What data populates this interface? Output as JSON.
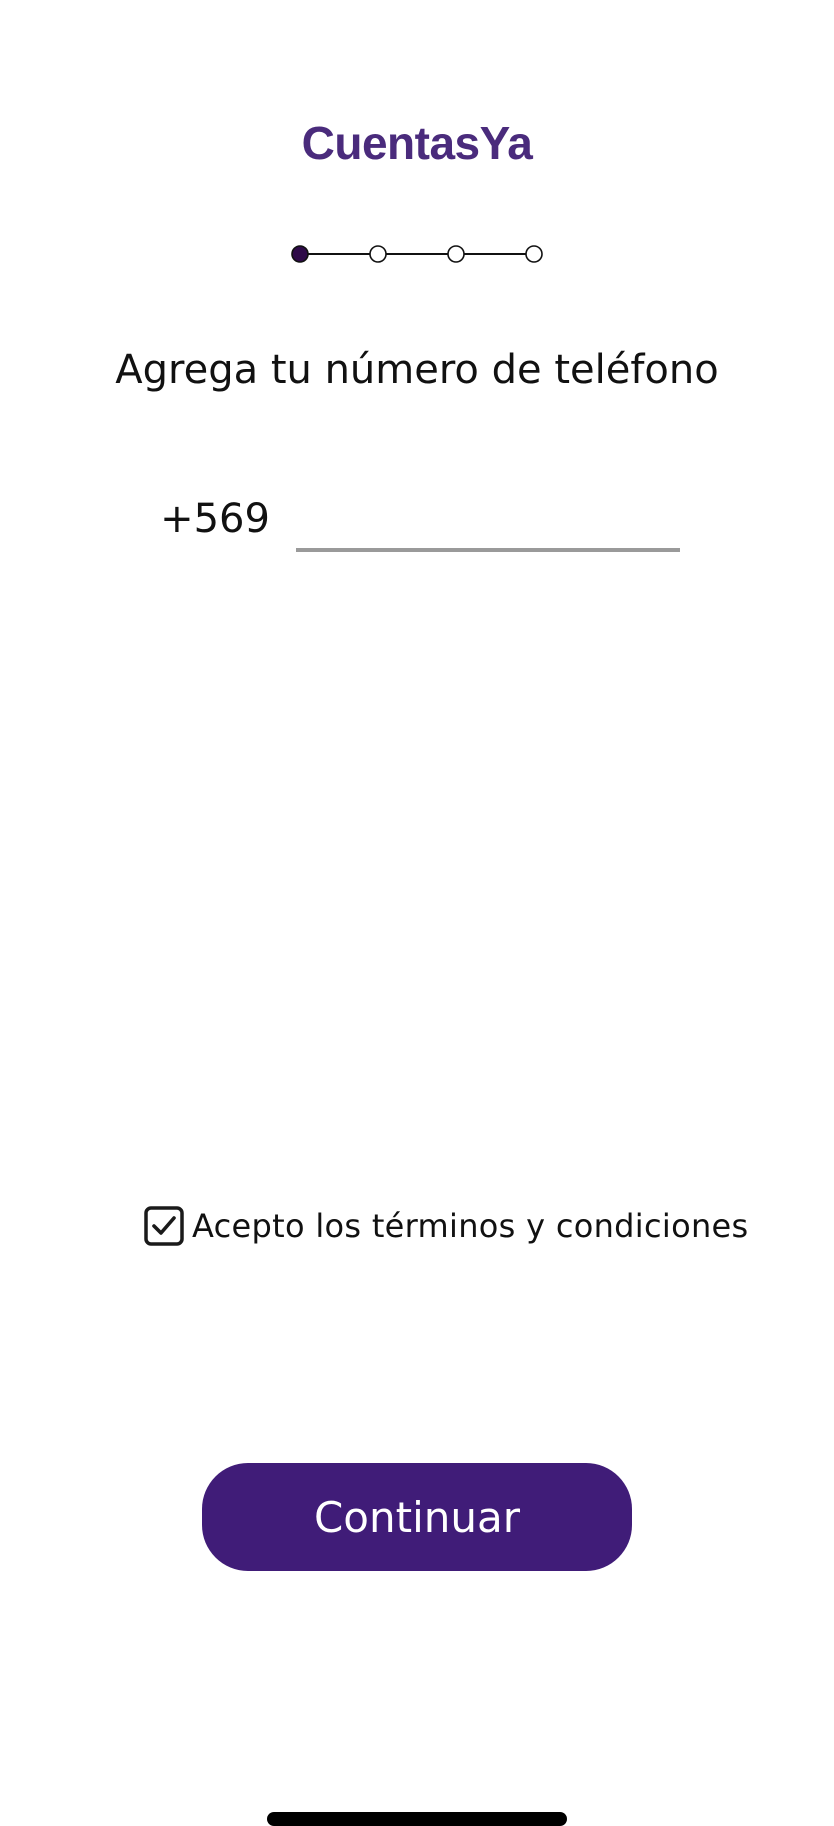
{
  "app": {
    "logo_text": "CuentasYa"
  },
  "stepper": {
    "total_steps": 4,
    "current_step": 1
  },
  "form": {
    "heading": "Agrega tu número de teléfono",
    "phone_prefix": "+569",
    "phone_value": "",
    "phone_placeholder": ""
  },
  "terms": {
    "label": "Acepto los términos y condiciones",
    "checked": true
  },
  "actions": {
    "continue_label": "Continuar"
  },
  "colors": {
    "brand": "#4a2b7c",
    "button_bg": "#401c78",
    "step_active": "#2e0a48",
    "input_underline": "#9a9a9a"
  },
  "icons": {
    "checkbox": "checkbox-checked-icon"
  }
}
